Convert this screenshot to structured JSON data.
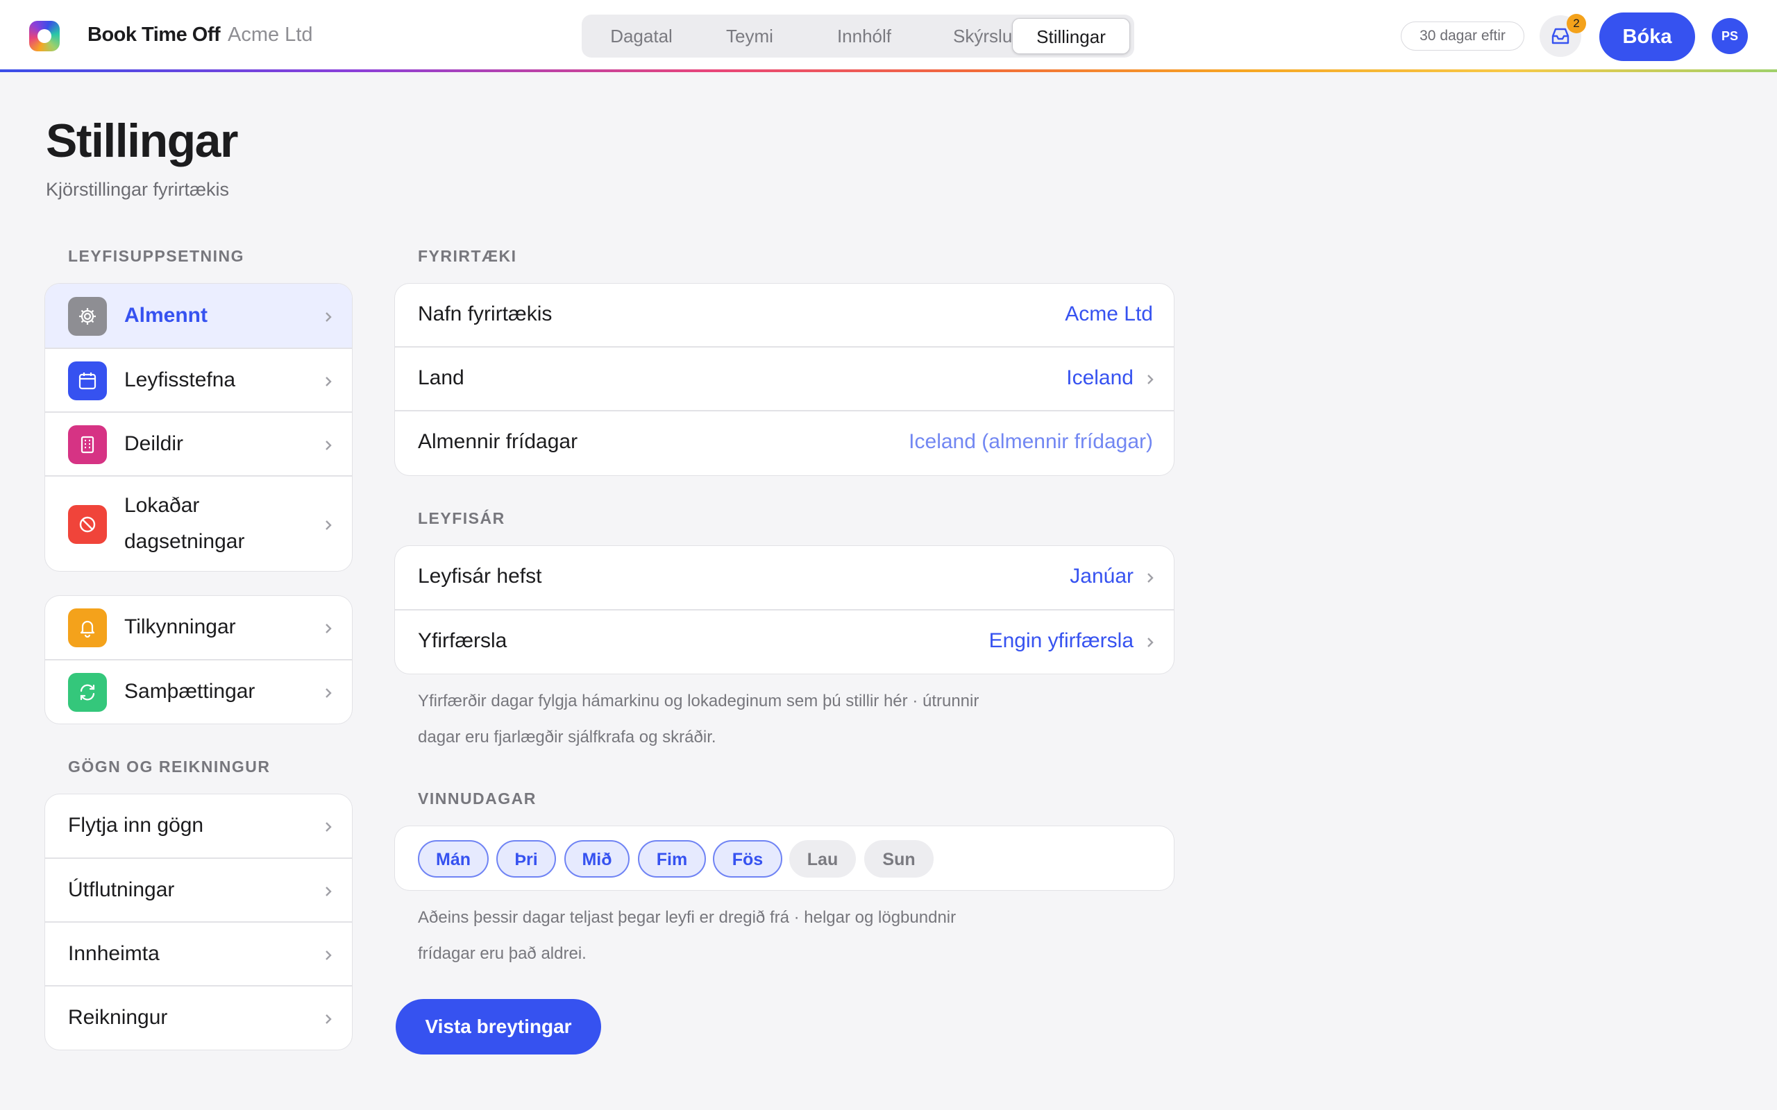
{
  "header": {
    "brand": "Book Time Off",
    "company": "Acme Ltd",
    "nav_tabs": [
      {
        "label": "Dagatal",
        "active": false
      },
      {
        "label": "Teymi",
        "active": false
      },
      {
        "label": "Innhólf",
        "active": false
      },
      {
        "label": "Skýrslur",
        "active": false
      },
      {
        "label": "Stillingar",
        "active": true
      }
    ],
    "days_left": "30 dagar eftir",
    "inbox_count": "2",
    "book_label": "Bóka",
    "avatar_initials": "PS"
  },
  "page": {
    "title": "Stillingar",
    "subtitle": "Kjörstillingar fyrirtækis"
  },
  "sidebar": {
    "section1_label": "LEYFISUPPSETNING",
    "items1": [
      {
        "label": "Almennt",
        "icon": "gear-icon",
        "color": "#8e8e93",
        "active": true
      },
      {
        "label": "Leyfisstefna",
        "icon": "calendar-icon",
        "color": "#3652f0",
        "active": false
      },
      {
        "label": "Deildir",
        "icon": "building-icon",
        "color": "#d63384",
        "active": false
      },
      {
        "label": "Lokaðar dagsetningar",
        "icon": "block-icon",
        "color": "#f0443a",
        "active": false
      }
    ],
    "items2": [
      {
        "label": "Tilkynningar",
        "icon": "bell-icon",
        "color": "#f4a21b"
      },
      {
        "label": "Samþættingar",
        "icon": "sync-icon",
        "color": "#34c77b"
      }
    ],
    "section2_label": "GÖGN OG REIKNINGUR",
    "items3": [
      {
        "label": "Flytja inn gögn"
      },
      {
        "label": "Útflutningar"
      },
      {
        "label": "Innheimta"
      },
      {
        "label": "Reikningur"
      }
    ]
  },
  "company": {
    "section_label": "FYRIRTÆKI",
    "name_label": "Nafn fyrirtækis",
    "name_value": "Acme Ltd",
    "country_label": "Land",
    "country_value": "Iceland",
    "holidays_label": "Almennir frídagar",
    "holidays_value": "Iceland (almennir frídagar)"
  },
  "leave_year": {
    "section_label": "LEYFISÁR",
    "start_label": "Leyfisár hefst",
    "start_value": "Janúar",
    "carryover_label": "Yfirfærsla",
    "carryover_value": "Engin yfirfærsla",
    "hint_line1": "Yfirfærðir dagar fylgja hámarkinu og lokadeginum sem þú stillir hér · útrunnir",
    "hint_line2": "dagar eru fjarlægðir sjálfkrafa og skráðir."
  },
  "work_days": {
    "section_label": "VINNUDAGAR",
    "days": [
      {
        "label": "Mán",
        "on": true
      },
      {
        "label": "Þri",
        "on": true
      },
      {
        "label": "Mið",
        "on": true
      },
      {
        "label": "Fim",
        "on": true
      },
      {
        "label": "Fös",
        "on": true
      },
      {
        "label": "Lau",
        "on": false
      },
      {
        "label": "Sun",
        "on": false
      }
    ],
    "hint_line1": "Aðeins þessir dagar teljast þegar leyfi er dregið frá · helgar og lögbundnir",
    "hint_line2": "frídagar eru það aldrei."
  },
  "save_label": "Vista breytingar"
}
